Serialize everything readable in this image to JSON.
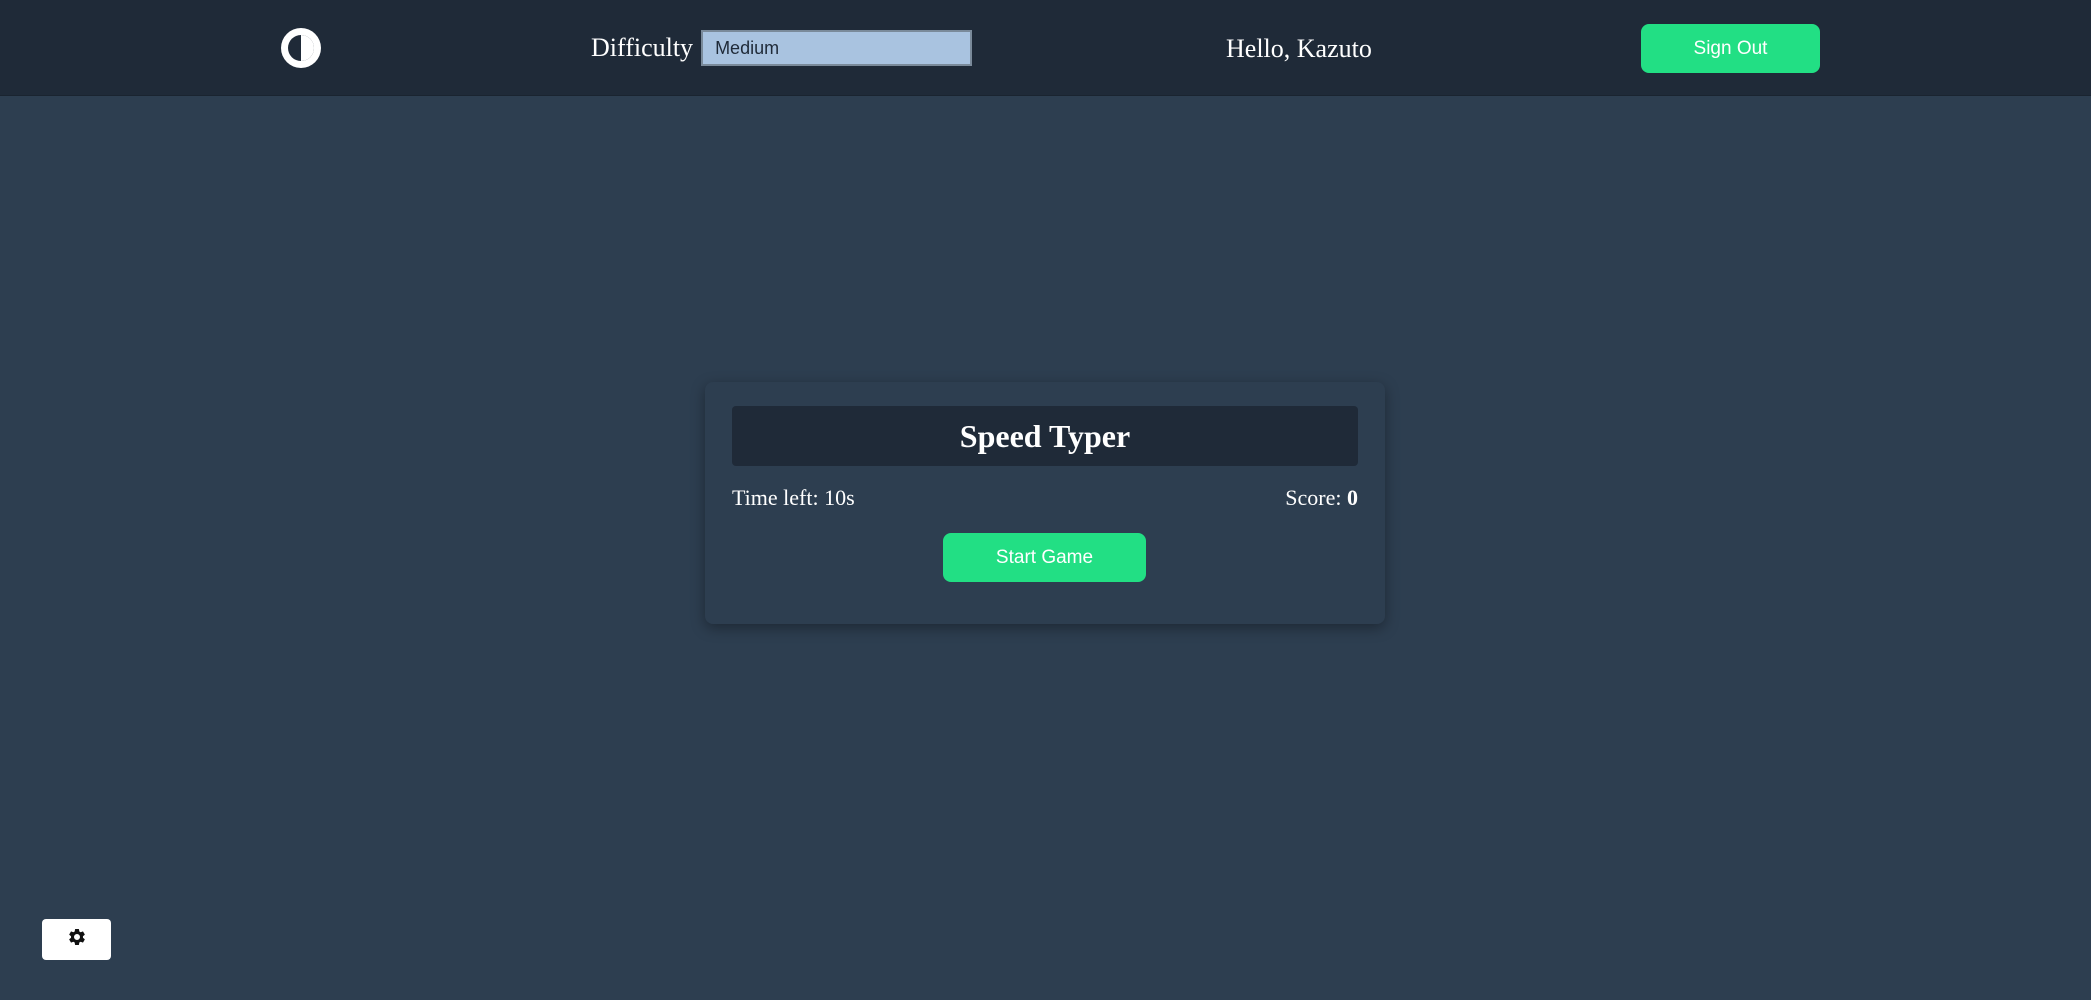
{
  "navbar": {
    "logo_icon": "contrast-toggle-icon",
    "difficulty_label": "Difficulty",
    "difficulty_selected": "Medium",
    "greeting": "Hello, Kazuto",
    "signout_label": "Sign Out"
  },
  "game": {
    "title": "Speed Typer",
    "time_left_label": "Time left: 10s",
    "score_label": "Score:",
    "score_value": "0",
    "start_label": "Start Game"
  },
  "settings": {
    "icon": "gear-icon"
  },
  "colors": {
    "background": "#2d3e50",
    "navbar": "#1f2a38",
    "accent": "#22df84",
    "select_bg": "#a9c3e0"
  }
}
